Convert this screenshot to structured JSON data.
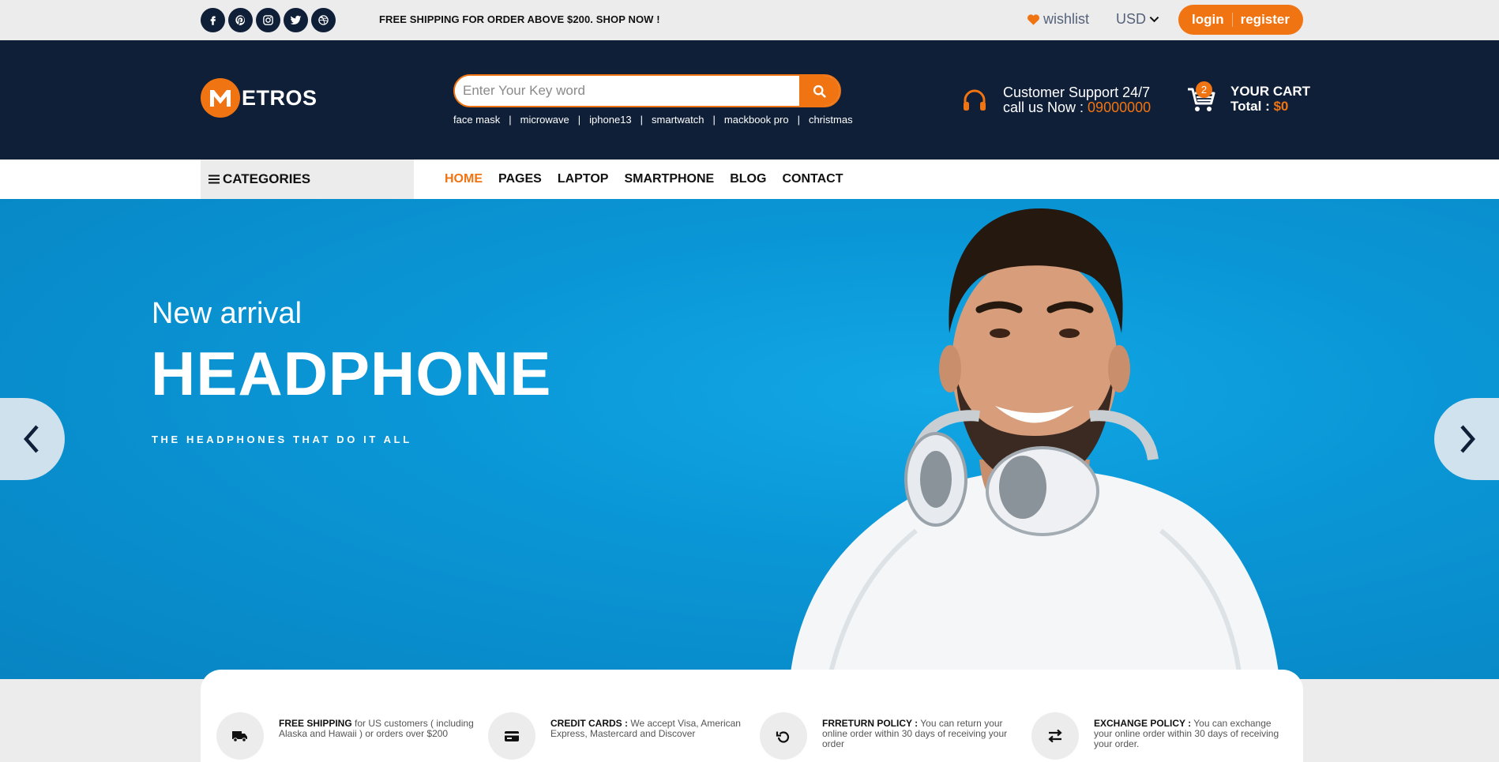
{
  "topbar": {
    "socials": [
      {
        "icon": "facebook-icon"
      },
      {
        "icon": "pinterest-icon"
      },
      {
        "icon": "instagram-icon"
      },
      {
        "icon": "twitter-icon"
      },
      {
        "icon": "dribbble-icon"
      }
    ],
    "promo": "FREE SHIPPING FOR ORDER ABOVE $200. SHOP NOW !",
    "wishlist_label": "wishlist",
    "currency": "USD",
    "login_label": "login",
    "register_label": "register"
  },
  "header": {
    "logo_text": "ETROS",
    "search": {
      "placeholder": "Enter Your Key word",
      "value": ""
    },
    "tags": [
      "face mask",
      "microwave",
      "iphone13",
      "smartwatch",
      "mackbook pro",
      "christmas"
    ],
    "support": {
      "title": "Customer Support 24/7",
      "call_label": "call us Now : ",
      "phone": "09000000"
    },
    "cart": {
      "count": "2",
      "title": "YOUR CART",
      "total_label": "Total : ",
      "total_value": "$0"
    }
  },
  "nav": {
    "categories_label": "CATEGORIES",
    "items": [
      "HOME",
      "PAGES",
      "LAPTOP",
      "SMARTPHONE",
      "BLOG",
      "CONTACT"
    ],
    "active": "HOME"
  },
  "hero": {
    "kicker": "New arrival",
    "title": "HEADPHONE",
    "tagline": "THE HEADPHONES THAT DO IT ALL"
  },
  "features": [
    {
      "icon": "truck-icon",
      "title": "FREE SHIPPING",
      "text": " for US customers ( including Alaska and Hawaii ) or orders over $200"
    },
    {
      "icon": "credit-card-icon",
      "title": "CREDIT CARDS :",
      "text": " We accept Visa, American Express, Mastercard and Discover"
    },
    {
      "icon": "return-icon",
      "title": "FRRETURN POLICY :",
      "text": " You can return your online order within 30 days of receiving your order"
    },
    {
      "icon": "exchange-icon",
      "title": "EXCHANGE POLICY :",
      "text": " You can exchange your online order within 30 days of receiving your order."
    }
  ],
  "colors": {
    "accent": "#f07412",
    "header_bg": "#0f1f38",
    "hero_bg": "#0a96d6",
    "topbar_bg": "#ececec"
  }
}
